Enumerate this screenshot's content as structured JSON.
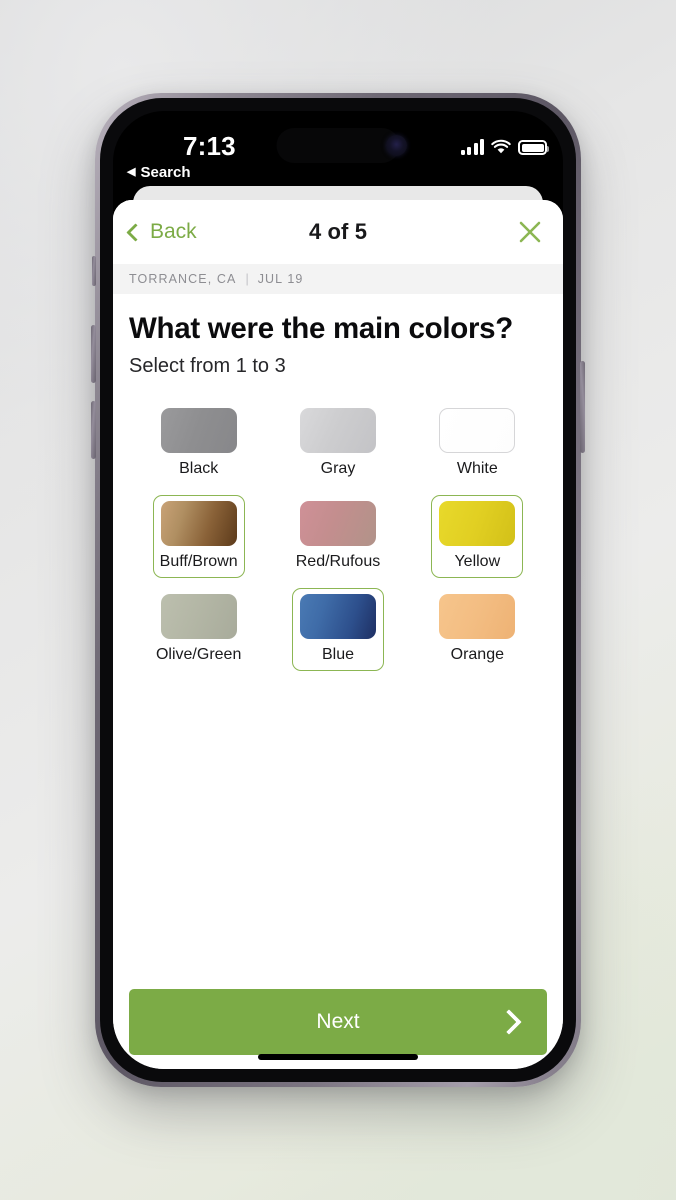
{
  "status_bar": {
    "time": "7:13",
    "back_app_label": "Search",
    "back_app_icon": "triangle-left-icon",
    "signal_icon": "cellular-signal-icon",
    "wifi_icon": "wifi-icon",
    "battery_icon": "battery-full-icon"
  },
  "navbar": {
    "back_label": "Back",
    "back_icon": "chevron-left-icon",
    "title": "4 of 5",
    "close_icon": "close-icon"
  },
  "meta": {
    "location": "TORRANCE, CA",
    "separator": "|",
    "date": "JUL 19"
  },
  "question": {
    "title": "What were the main colors?",
    "subtitle": "Select from 1 to 3"
  },
  "colors": [
    {
      "label": "Black",
      "swatch": "black-swatch",
      "selected": false,
      "outlined": false,
      "gradient": "linear-gradient(110deg,#9a9a9c 0%,#8e8e90 48%,#87878a 100%)"
    },
    {
      "label": "Gray",
      "swatch": "gray-swatch",
      "selected": false,
      "outlined": false,
      "gradient": "linear-gradient(115deg,#d9d9db 0%,#cdcdcf 45%,#c3c3c6 100%)"
    },
    {
      "label": "White",
      "swatch": "white-swatch",
      "selected": false,
      "outlined": true,
      "gradient": "linear-gradient(110deg,#ffffff 0%,#fdfdfd 100%)"
    },
    {
      "label": "Buff/Brown",
      "swatch": "buff-brown-swatch",
      "selected": true,
      "outlined": false,
      "gradient": "linear-gradient(108deg,#c9a277 0%,#b08f62 28%,#8a6238 62%,#5c3a1a 100%)"
    },
    {
      "label": "Red/Rufous",
      "swatch": "red-rufous-swatch",
      "selected": false,
      "outlined": false,
      "gradient": "linear-gradient(112deg,#cf9097 0%,#c38e8e 45%,#b19389 100%)"
    },
    {
      "label": "Yellow",
      "swatch": "yellow-swatch",
      "selected": true,
      "outlined": false,
      "gradient": "linear-gradient(110deg,#e8d92b 0%,#e1cf22 50%,#d2c018 100%)"
    },
    {
      "label": "Olive/Green",
      "swatch": "olive-green-swatch",
      "selected": false,
      "outlined": false,
      "gradient": "linear-gradient(112deg,#bcbfae 0%,#b3b6a5 48%,#a8ab9b 100%)"
    },
    {
      "label": "Blue",
      "swatch": "blue-swatch",
      "selected": true,
      "outlined": false,
      "gradient": "linear-gradient(108deg,#4a7ab4 0%,#3f6ca8 30%,#2d4f8c 68%,#1e2f63 100%)"
    },
    {
      "label": "Orange",
      "swatch": "orange-swatch",
      "selected": false,
      "outlined": false,
      "gradient": "linear-gradient(112deg,#f6c58c 0%,#f3bd82 50%,#eeb274 100%)"
    }
  ],
  "footer": {
    "next_label": "Next",
    "next_icon": "chevron-right-icon"
  },
  "theme": {
    "accent_green": "#7cab46",
    "selection_green": "#8cb653"
  }
}
